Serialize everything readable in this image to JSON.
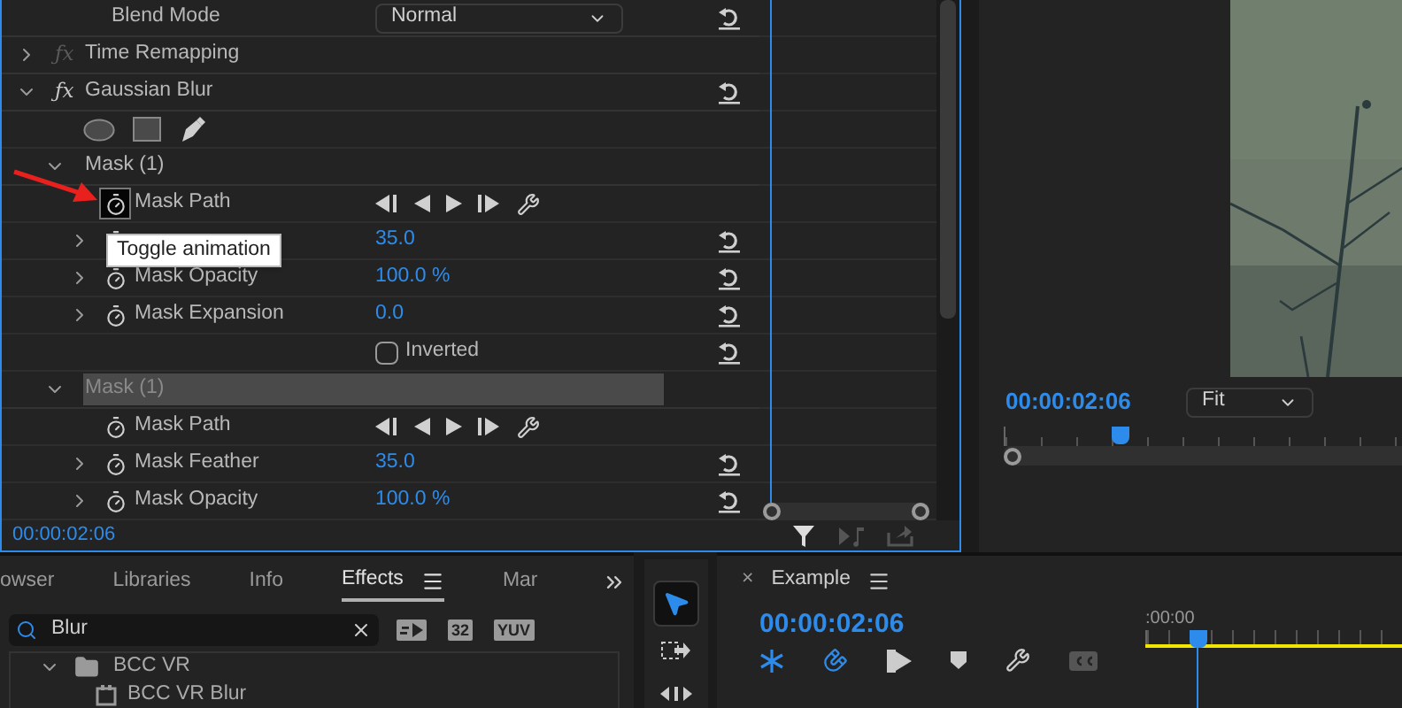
{
  "effect_controls": {
    "rows": [
      {
        "kind": "dropdown",
        "label": "Blend Mode",
        "value": "Normal",
        "reset": true
      },
      {
        "kind": "effect",
        "icon": "ƒx",
        "label": "Time Remapping",
        "expanded": false,
        "enabled": false
      },
      {
        "kind": "effect",
        "icon": "ƒx",
        "label": "Gaussian Blur",
        "expanded": true,
        "enabled": true,
        "reset": true
      },
      {
        "kind": "shapes"
      },
      {
        "kind": "mask",
        "label": "Mask (1)",
        "expanded": true,
        "selected": false
      },
      {
        "kind": "property",
        "label": "Mask Path",
        "keyframes": true,
        "hovered": true
      },
      {
        "kind": "property",
        "expanded": false,
        "value": "35.0",
        "reset": true
      },
      {
        "kind": "property",
        "label": "Mask Opacity",
        "expanded": false,
        "value": "100.0 %",
        "reset": true
      },
      {
        "kind": "property",
        "label": "Mask Expansion",
        "expanded": false,
        "value": "0.0",
        "reset": true
      },
      {
        "kind": "checkbox",
        "label": "Inverted",
        "checked": false,
        "reset": true
      },
      {
        "kind": "mask",
        "label": "Mask (1)",
        "expanded": true,
        "selected": true
      },
      {
        "kind": "property",
        "label": "Mask Path",
        "keyframes": true,
        "hovered": false
      },
      {
        "kind": "property",
        "label": "Mask Feather",
        "expanded": false,
        "value": "35.0",
        "reset": true
      },
      {
        "kind": "property",
        "label": "Mask Opacity",
        "expanded": false,
        "value": "100.0 %",
        "reset": true
      }
    ],
    "tooltip": "Toggle animation",
    "timecode": "00:00:02:06"
  },
  "program_monitor": {
    "timecode": "00:00:02:06",
    "zoom": "Fit",
    "level": 0.27
  },
  "effects_panel": {
    "tabs": [
      {
        "label": "owser",
        "selected": false,
        "menu": false
      },
      {
        "label": "Libraries",
        "selected": false,
        "menu": false
      },
      {
        "label": "Info",
        "selected": false,
        "menu": false
      },
      {
        "label": "Effects",
        "selected": true,
        "menu": true
      },
      {
        "label": "Mar",
        "selected": false,
        "menu": false
      }
    ],
    "search": {
      "value": "Blur"
    },
    "badges": [
      {
        "kind": "accelerated"
      },
      {
        "kind": "text",
        "label": "32"
      },
      {
        "kind": "text",
        "label": "YUV"
      }
    ],
    "tree": [
      {
        "label": "BCC VR",
        "expanded": true,
        "children": [
          {
            "label": "BCC VR Blur"
          }
        ]
      }
    ]
  },
  "tools": [
    {
      "kind": "selection",
      "selected": true
    },
    {
      "kind": "track-select",
      "selected": false
    },
    {
      "kind": "ripple",
      "selected": false
    }
  ],
  "timeline": {
    "close": "×",
    "title": "Example",
    "timecode": "00:00:02:06",
    "ruler_label": ":00:00"
  }
}
